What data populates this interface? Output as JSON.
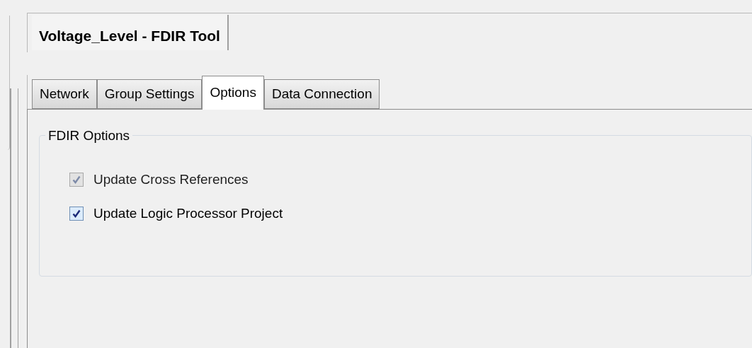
{
  "document_tab": {
    "title": "Voltage_Level - FDIR Tool"
  },
  "tabs": [
    {
      "label": "Network",
      "selected": false
    },
    {
      "label": "Group Settings",
      "selected": false
    },
    {
      "label": "Options",
      "selected": true
    },
    {
      "label": "Data Connection",
      "selected": false
    }
  ],
  "group": {
    "title": "FDIR Options",
    "options": [
      {
        "label": "Update Cross References",
        "checked": true,
        "disabled": true
      },
      {
        "label": "Update Logic Processor Project",
        "checked": true,
        "disabled": false
      }
    ]
  }
}
